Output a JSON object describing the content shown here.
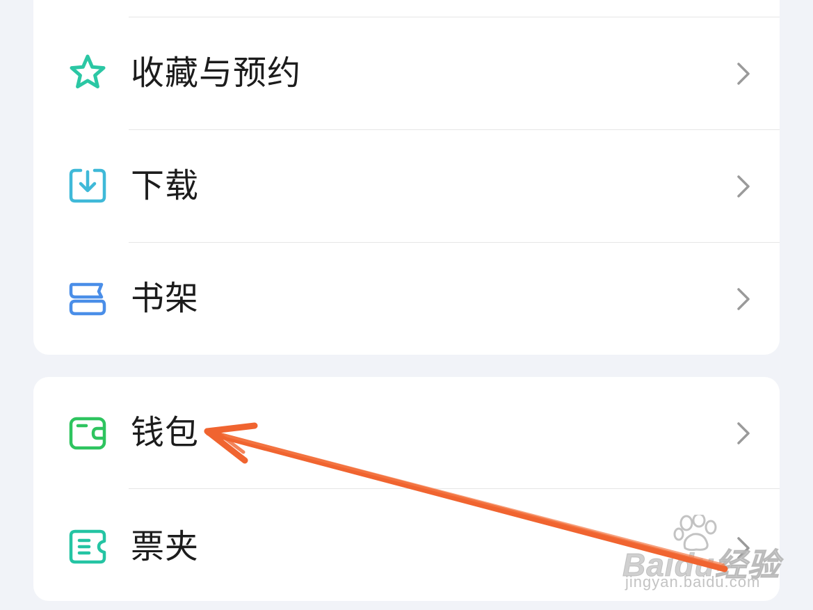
{
  "menu": {
    "items": [
      {
        "label": "收藏与预约",
        "icon": "star-icon",
        "color": "#2bc7a4"
      },
      {
        "label": "下载",
        "icon": "download-icon",
        "color": "#3fb9d8"
      },
      {
        "label": "书架",
        "icon": "bookshelf-icon",
        "color": "#4a8ee8"
      },
      {
        "label": "钱包",
        "icon": "wallet-icon",
        "color": "#2ec45f"
      },
      {
        "label": "票夹",
        "icon": "ticket-icon",
        "color": "#24c4a3"
      }
    ]
  },
  "annotation": {
    "arrow_color": "#f06430",
    "points_to": "钱包"
  },
  "watermark": {
    "logo_text": "Baidu经验",
    "url": "jingyan.baidu.com"
  },
  "colors": {
    "background": "#f1f3f8",
    "card": "#ffffff",
    "chevron": "#9a9a9a"
  }
}
